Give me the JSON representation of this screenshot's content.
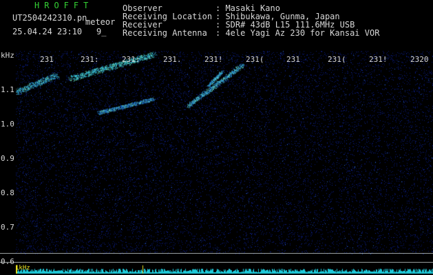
{
  "header": {
    "logo": "HROFFT",
    "filename": "UT2504242310.pn",
    "tag": "meteor",
    "datetime": "25.04.24 23:10",
    "count": "9_"
  },
  "info": {
    "labels": [
      "Observer",
      "Receiving Location",
      "Receiver",
      "Receiving Antenna"
    ],
    "values": [
      ": Masaki Kano",
      ": Shibukawa, Gunma, Japan",
      ": SDR# 43dB L15 111.6MHz USB",
      ": 4ele Yagi Az 230 for Kansai VOR"
    ]
  },
  "axis": {
    "unit": "kHz",
    "y_ticks": [
      "1.1",
      "1.0",
      "0.9",
      "0.8",
      "0.7",
      "0.6"
    ],
    "time_ticks": [
      "231",
      "231:",
      "231:",
      "231.",
      "231!",
      "231(",
      "231",
      "231(",
      "231!",
      "2320"
    ]
  },
  "bottom": {
    "label": "1kHz"
  },
  "colors": {
    "background": "#000000",
    "text": "#d8d8d8",
    "logo": "#34d034",
    "noise": "#0a1e8c",
    "trail": "#34c8e8",
    "bottom_bars": "#1ec8d8"
  }
}
